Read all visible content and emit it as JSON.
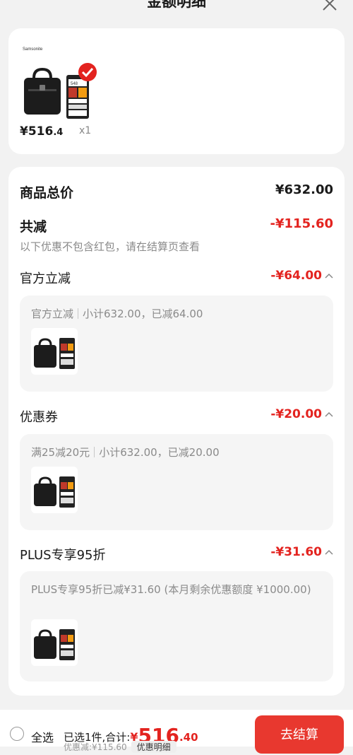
{
  "header": {
    "title": "金额明细"
  },
  "product": {
    "brand": "Samsonite",
    "badge_text": "548",
    "price_int": "¥516",
    "price_dec": ".4",
    "qty": "x1"
  },
  "summary": {
    "total_label": "商品总价",
    "total_value": "¥632.00",
    "reduce_label": "共减",
    "reduce_value": "-¥115.60",
    "note": "以下优惠不包含红包，请在结算页查看"
  },
  "discounts": [
    {
      "label": "官方立减",
      "value": "-¥64.00",
      "detail_a": "官方立减",
      "detail_b": "小计632.00，已减64.00"
    },
    {
      "label": "优惠券",
      "value": "-¥20.00",
      "detail_a": "满25减20元",
      "detail_b": "小计632.00，已减20.00"
    },
    {
      "label": "PLUS专享95折",
      "value": "-¥31.60",
      "detail_a": "PLUS专享95折已减¥31.60 (本月剩余优惠额度 ¥1000.00)",
      "detail_b": ""
    }
  ],
  "bottom_bar": {
    "select_all": "全选",
    "selected_text": "已选1件,合计:",
    "yen": "¥",
    "total_int": "516",
    "total_dec": ".40",
    "discount_text": "优惠减:¥115.60",
    "detail_button": "优惠明细",
    "checkout_button": "去结算"
  },
  "colors": {
    "accent": "#e3231f",
    "checkout_bg": "#e8382f",
    "page_bg": "#f2f2f2"
  }
}
